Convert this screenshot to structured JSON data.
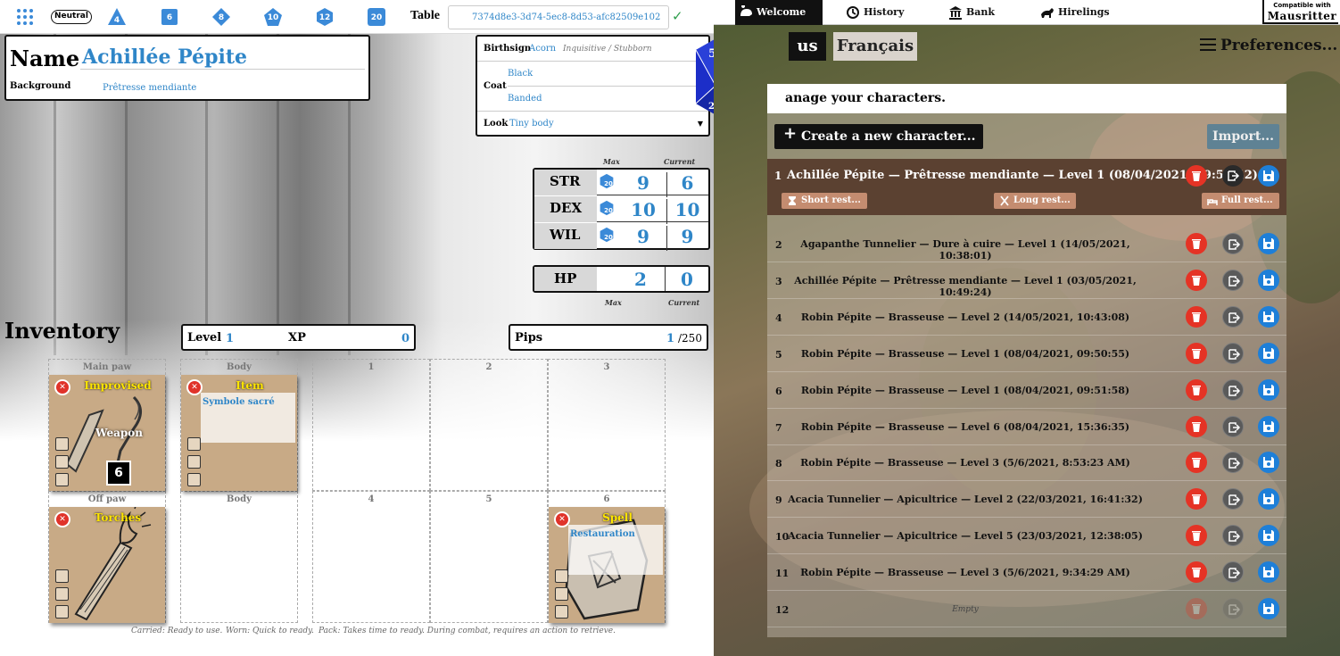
{
  "topbar": {
    "alignment": "Neutral",
    "dice": [
      "4",
      "6",
      "8",
      "10",
      "12",
      "20"
    ],
    "table_label": "Table",
    "table_id": "7374d8e3-3d74-5ec8-8d53-afc82509e102"
  },
  "identity": {
    "name_label": "Name",
    "name": "Achillée Pépite",
    "background_label": "Background",
    "background": "Prêtresse mendiante"
  },
  "traits": {
    "birthsign_label": "Birthsign",
    "birthsign": "Acorn",
    "birthsign_hint": "Inquisitive / Stubborn",
    "coat_label": "Coat",
    "coat_color": "Black",
    "coat_pattern": "Banded",
    "look_label": "Look",
    "look": "Tiny body"
  },
  "big_die": {
    "faces": [
      "4",
      "5",
      "6",
      "19",
      "3",
      "20",
      "2"
    ]
  },
  "stats": {
    "max_label": "Max",
    "current_label": "Current",
    "die": "20",
    "rows": [
      {
        "label": "STR",
        "max": "9",
        "current": "6"
      },
      {
        "label": "DEX",
        "max": "10",
        "current": "10"
      },
      {
        "label": "WIL",
        "max": "9",
        "current": "9"
      }
    ]
  },
  "hp": {
    "label": "HP",
    "max": "2",
    "current": "0",
    "max_label": "Max",
    "current_label": "Current"
  },
  "inventory": {
    "title": "Inventory",
    "level_label": "Level",
    "level": "1",
    "xp_label": "XP",
    "xp": "0",
    "pips_label": "Pips",
    "pips": "1",
    "pips_max": "/250",
    "slots": {
      "main_paw": "Main paw",
      "body1": "Body",
      "off_paw": "Off paw",
      "body2": "Body",
      "pack": [
        "1",
        "2",
        "3",
        "4",
        "5",
        "6"
      ]
    },
    "cards": {
      "weapon": {
        "title": "Improvised",
        "label": "Weapon",
        "usage": "6"
      },
      "item": {
        "title": "Item",
        "note": "Symbole sacré"
      },
      "torches": {
        "title": "Torches"
      },
      "spell": {
        "title": "Spell",
        "note": "Restauration"
      }
    },
    "legend": {
      "carried": "Carried: Ready to use.",
      "worn": "Worn: Quick to ready.",
      "pack": "Pack: Takes time to ready. During combat, requires an action to retrieve."
    }
  },
  "right": {
    "tabs": [
      "Welcome",
      "History",
      "Bank",
      "Hirelings"
    ],
    "logo_small": "Compatible with",
    "logo_big": "Mausritter",
    "lang_active": "us",
    "lang_other": "Français",
    "preferences": "Preferences...",
    "heading": "anage your characters.",
    "create": "Create a new character...",
    "import": "Import...",
    "selected": {
      "num": "1",
      "text": "Achillée Pépite — Prêtresse mendiante — Level 1 (08/04/2021, 09:50:42)"
    },
    "rest": {
      "short": "Short rest...",
      "long": "Long rest...",
      "full": "Full rest..."
    },
    "rows": [
      {
        "num": "2",
        "text": "Agapanthe Tunnelier — Dure à cuire — Level 1 (14/05/2021, 10:38:01)"
      },
      {
        "num": "3",
        "text": "Achillée Pépite — Prêtresse mendiante — Level 1 (03/05/2021, 10:49:24)"
      },
      {
        "num": "4",
        "text": "Robin Pépite — Brasseuse — Level 2 (14/05/2021, 10:43:08)"
      },
      {
        "num": "5",
        "text": "Robin Pépite — Brasseuse — Level 1 (08/04/2021, 09:50:55)"
      },
      {
        "num": "6",
        "text": "Robin Pépite — Brasseuse — Level 1 (08/04/2021, 09:51:58)"
      },
      {
        "num": "7",
        "text": "Robin Pépite — Brasseuse — Level 6 (08/04/2021, 15:36:35)"
      },
      {
        "num": "8",
        "text": "Robin Pépite — Brasseuse — Level 3 (5/6/2021, 8:53:23 AM)"
      },
      {
        "num": "9",
        "text": "Acacia Tunnelier — Apicultrice — Level 2 (22/03/2021, 16:41:32)"
      },
      {
        "num": "10",
        "text": "Acacia Tunnelier — Apicultrice — Level 5 (23/03/2021, 12:38:05)"
      },
      {
        "num": "11",
        "text": "Robin Pépite — Brasseuse — Level 3 (5/6/2021, 9:34:29 AM)"
      },
      {
        "num": "12",
        "text": "Empty"
      }
    ]
  },
  "colors": {
    "accent": "#2f86c8",
    "delete": "#e53325",
    "save": "#1e7fd8",
    "selected_row": "#5b4131",
    "card": "#c8aa86"
  }
}
